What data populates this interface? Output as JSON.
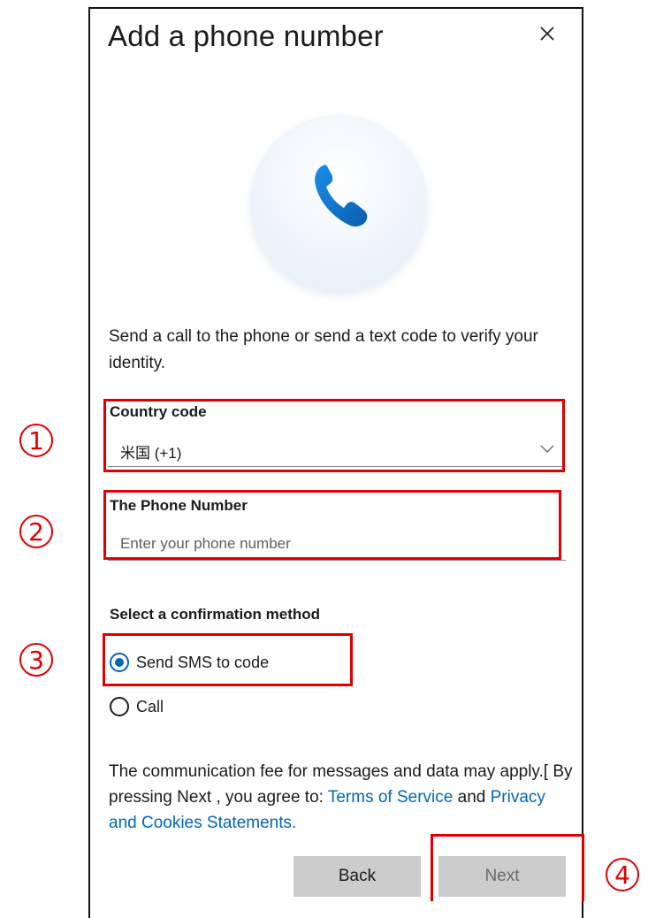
{
  "dialog": {
    "title": "Add a phone number",
    "intro": "Send a call to the phone or send a text code to verify your identity."
  },
  "country": {
    "label": "Country code",
    "value": "米国 (+1)"
  },
  "phone": {
    "label": "The Phone Number",
    "placeholder": "Enter your phone number",
    "value": ""
  },
  "method": {
    "label": "Select a confirmation method",
    "options": [
      {
        "label": "Send SMS to code",
        "selected": true
      },
      {
        "label": "Call",
        "selected": false
      }
    ]
  },
  "fee": {
    "text_before": "The communication fee for messages and data may apply.[ By pressing Next , you agree to: ",
    "terms_link": "Terms of Service",
    "text_middle": " and ",
    "privacy_link": "Privacy and Cookies Statements."
  },
  "buttons": {
    "back": "Back",
    "next": "Next"
  },
  "annotations": {
    "markers": [
      "1",
      "2",
      "3",
      "4"
    ],
    "color": "#e00000"
  },
  "colors": {
    "accent": "#0067b8",
    "button_bg": "#cccccc"
  },
  "icons": {
    "close": "close-icon",
    "phone": "phone-icon",
    "chevron": "chevron-down-icon"
  }
}
